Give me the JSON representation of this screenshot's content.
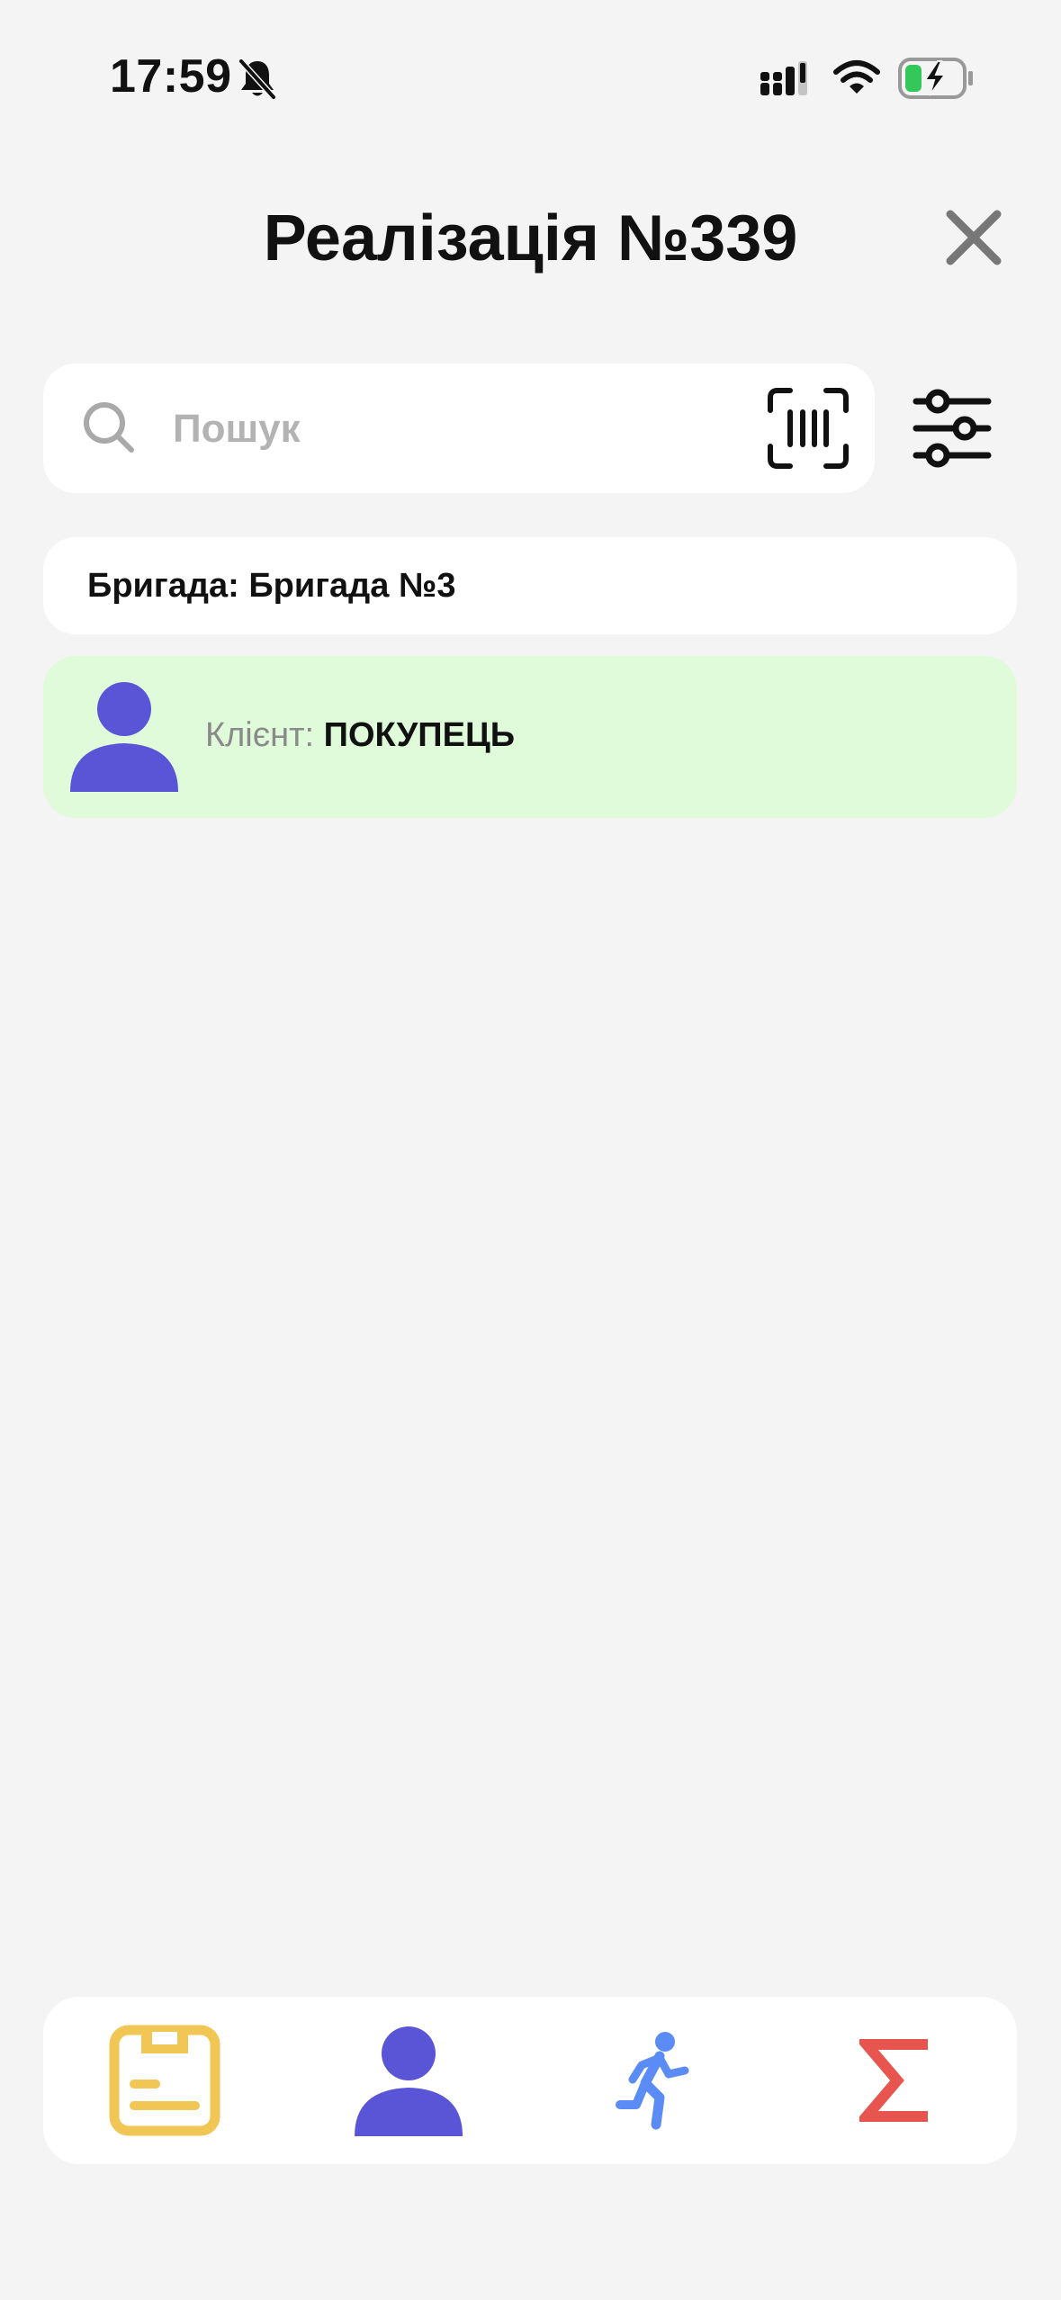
{
  "status_bar": {
    "time": "17:59",
    "icons": [
      "bell-slash-icon",
      "cellular-signal-icon",
      "wifi-icon",
      "battery-charging-icon"
    ]
  },
  "header": {
    "title": "Реалізація №339",
    "close_icon": "close-icon"
  },
  "search": {
    "placeholder": "Пошук",
    "value": "",
    "icons": [
      "search-icon",
      "barcode-scan-icon",
      "filter-sliders-icon"
    ]
  },
  "brigade": {
    "text": "Бригада: Бригада №3"
  },
  "client": {
    "label": "Клієнт: ",
    "value": "ПОКУПЕЦЬ",
    "avatar_icon": "person-icon"
  },
  "bottom_nav": {
    "items": [
      {
        "icon": "save-document-icon"
      },
      {
        "icon": "person-icon"
      },
      {
        "icon": "running-person-icon"
      },
      {
        "icon": "sigma-sum-icon"
      }
    ]
  },
  "colors": {
    "background": "#f4f4f4",
    "card": "#ffffff",
    "client_card": "#dffbd9",
    "accent_purple": "#5a55d6",
    "save_yellow": "#f2c655",
    "run_blue": "#5b8cf5",
    "sum_red": "#e8554e",
    "close_gray": "#777777",
    "placeholder_gray": "#b3b3b3"
  }
}
